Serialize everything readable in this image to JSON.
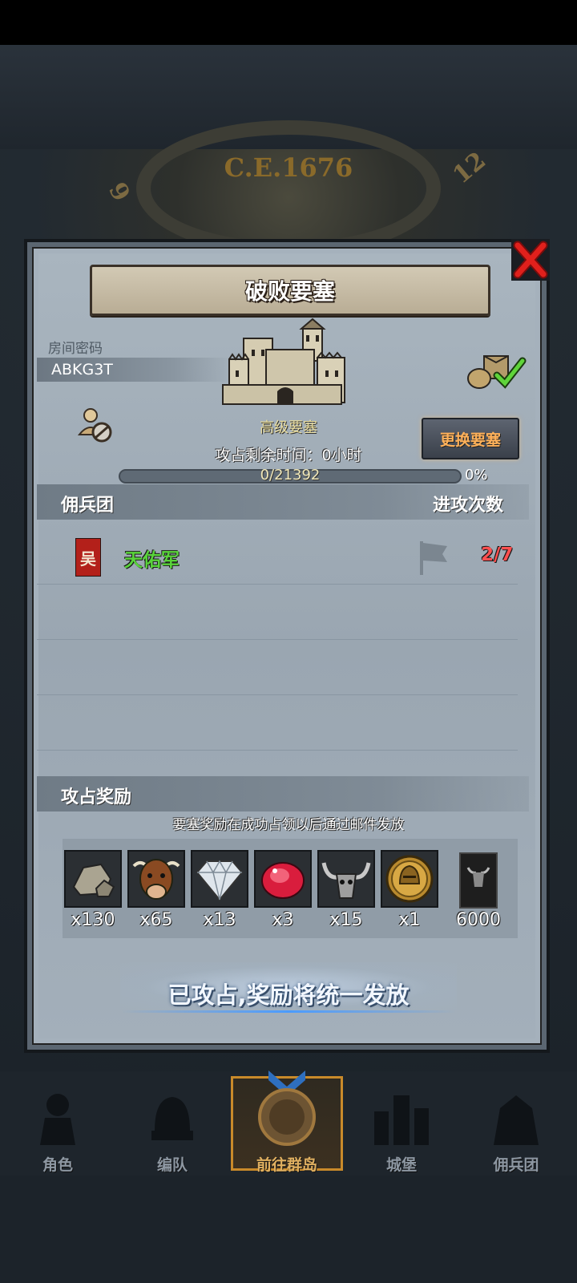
{
  "background": {
    "era_label": "C.E.1676",
    "clock_numbers": [
      "12",
      "9"
    ]
  },
  "dialog": {
    "title": "破败要塞",
    "room_label": "房间密码",
    "room_code": "ABKG3T",
    "fortress_name": "高级要塞",
    "swap_button": "更换要塞",
    "remaining_time": "攻占剩余时间：0小时",
    "progress": {
      "text": "0/21392",
      "percent_label": "0%",
      "fraction": 0
    },
    "mercenary_header": "佣兵团",
    "attack_count_header": "进攻次数",
    "mercenaries": [
      {
        "name": "天佑军",
        "attacks": "2/7",
        "emblem_char": "吴"
      }
    ],
    "reward_header": "攻占奖励",
    "reward_note": "要塞奖励在成功占领以后通过邮件发放",
    "rewards": [
      {
        "icon": "stone-ore-icon",
        "qty": "x130"
      },
      {
        "icon": "cattle-icon",
        "qty": "x65"
      },
      {
        "icon": "diamond-icon",
        "qty": "x13"
      },
      {
        "icon": "ruby-icon",
        "qty": "x3"
      },
      {
        "icon": "horned-skull-icon",
        "qty": "x15"
      },
      {
        "icon": "golden-helmet-coin-icon",
        "qty": "x1"
      },
      {
        "icon": "banner-bull-icon",
        "qty": "6000"
      }
    ],
    "status_message": "已攻占,奖励将统一发放"
  },
  "bottom_nav": [
    {
      "label": "角色",
      "icon": "knight-icon",
      "active": false
    },
    {
      "label": "编队",
      "icon": "helmet-icon",
      "active": false
    },
    {
      "label": "前往群岛",
      "icon": "island-emblem-icon",
      "active": true
    },
    {
      "label": "城堡",
      "icon": "castle-icon",
      "active": false
    },
    {
      "label": "佣兵团",
      "icon": "mercenary-icon",
      "active": false
    }
  ],
  "colors": {
    "guild_name": "#59d33b",
    "attack_count": "#ff5050",
    "swap_button_text": "#ffb15a",
    "status_glow": "#4a9bff"
  }
}
